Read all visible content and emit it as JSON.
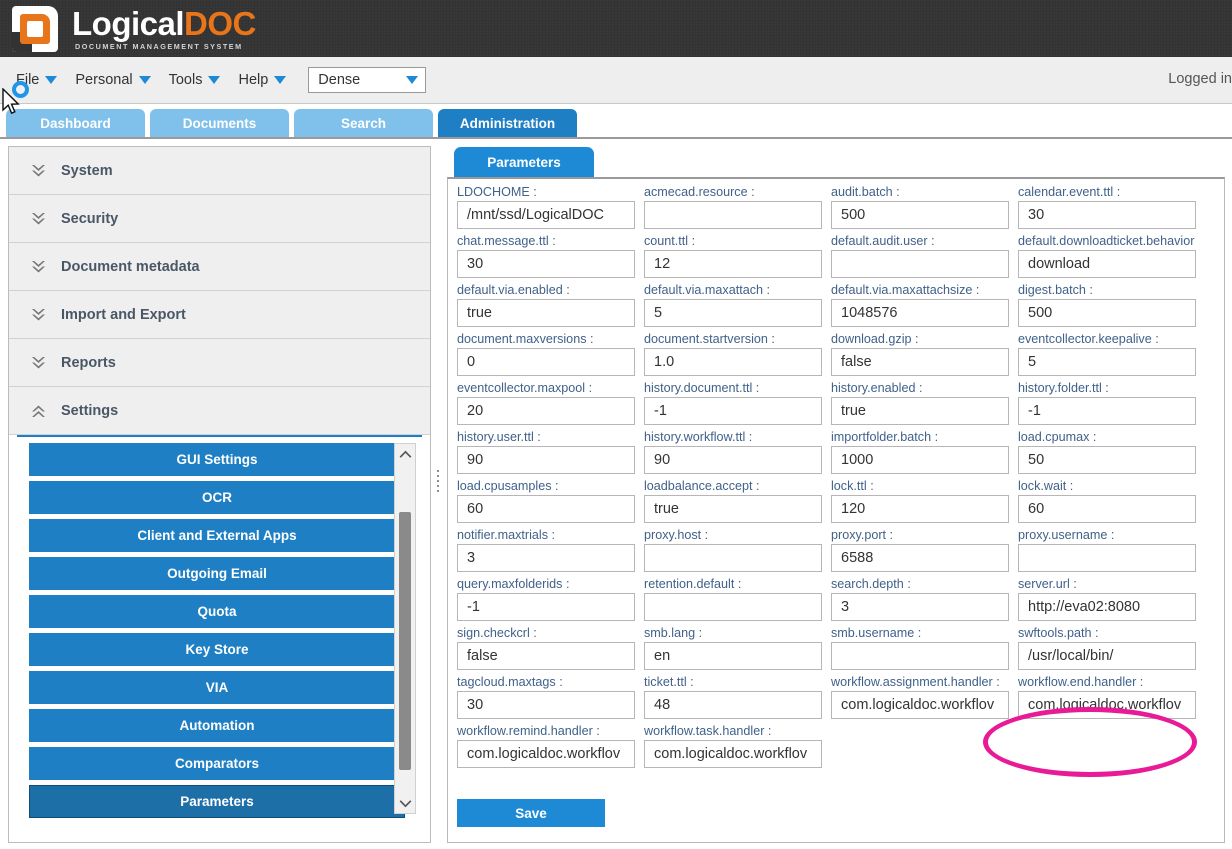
{
  "brand": {
    "name_part1": "Logical",
    "name_part2": "DOC",
    "tagline": "DOCUMENT MANAGEMENT SYSTEM",
    "orange": "#e8751a",
    "blue": "#1e8ad6"
  },
  "menubar": {
    "items": [
      {
        "label": "File",
        "icon": "chevron-down-icon"
      },
      {
        "label": "Personal",
        "icon": "chevron-down-icon"
      },
      {
        "label": "Tools",
        "icon": "chevron-down-icon"
      },
      {
        "label": "Help",
        "icon": "chevron-down-icon"
      }
    ],
    "density": {
      "value": "Dense",
      "icon": "chevron-down-icon"
    },
    "status": "Logged in"
  },
  "tabs": [
    {
      "label": "Dashboard",
      "active": false
    },
    {
      "label": "Documents",
      "active": false
    },
    {
      "label": "Search",
      "active": false
    },
    {
      "label": "Administration",
      "active": true
    }
  ],
  "sidebar": {
    "sections": [
      {
        "label": "System",
        "expanded": false
      },
      {
        "label": "Security",
        "expanded": false
      },
      {
        "label": "Document metadata",
        "expanded": false
      },
      {
        "label": "Import and Export",
        "expanded": false
      },
      {
        "label": "Reports",
        "expanded": false
      },
      {
        "label": "Settings",
        "expanded": true
      }
    ],
    "settings_items": [
      {
        "label": "GUI Settings",
        "selected": false
      },
      {
        "label": "OCR",
        "selected": false
      },
      {
        "label": "Client and External Apps",
        "selected": false
      },
      {
        "label": "Outgoing Email",
        "selected": false
      },
      {
        "label": "Quota",
        "selected": false
      },
      {
        "label": "Key Store",
        "selected": false
      },
      {
        "label": "VIA",
        "selected": false
      },
      {
        "label": "Automation",
        "selected": false
      },
      {
        "label": "Comparators",
        "selected": false
      },
      {
        "label": "Parameters",
        "selected": true
      }
    ]
  },
  "main": {
    "tab_label": "Parameters",
    "save_label": "Save",
    "parameters": [
      {
        "label": "LDOCHOME :",
        "value": "/mnt/ssd/LogicalDOC"
      },
      {
        "label": "acmecad.resource :",
        "value": ""
      },
      {
        "label": "audit.batch :",
        "value": "500"
      },
      {
        "label": "calendar.event.ttl :",
        "value": "30"
      },
      {
        "label": "chat.message.ttl :",
        "value": "30"
      },
      {
        "label": "count.ttl :",
        "value": "12"
      },
      {
        "label": "default.audit.user :",
        "value": ""
      },
      {
        "label": "default.downloadticket.behavior :",
        "value": "download"
      },
      {
        "label": "default.via.enabled :",
        "value": "true"
      },
      {
        "label": "default.via.maxattach :",
        "value": "5"
      },
      {
        "label": "default.via.maxattachsize :",
        "value": "1048576"
      },
      {
        "label": "digest.batch :",
        "value": "500"
      },
      {
        "label": "document.maxversions :",
        "value": "0"
      },
      {
        "label": "document.startversion :",
        "value": "1.0"
      },
      {
        "label": "download.gzip :",
        "value": "false"
      },
      {
        "label": "eventcollector.keepalive :",
        "value": "5"
      },
      {
        "label": "eventcollector.maxpool :",
        "value": "20"
      },
      {
        "label": "history.document.ttl :",
        "value": "-1"
      },
      {
        "label": "history.enabled :",
        "value": "true"
      },
      {
        "label": "history.folder.ttl :",
        "value": "-1"
      },
      {
        "label": "history.user.ttl :",
        "value": "90"
      },
      {
        "label": "history.workflow.ttl :",
        "value": "90"
      },
      {
        "label": "importfolder.batch :",
        "value": "1000"
      },
      {
        "label": "load.cpumax :",
        "value": "50"
      },
      {
        "label": "load.cpusamples :",
        "value": "60"
      },
      {
        "label": "loadbalance.accept :",
        "value": "true"
      },
      {
        "label": "lock.ttl :",
        "value": "120"
      },
      {
        "label": "lock.wait :",
        "value": "60"
      },
      {
        "label": "notifier.maxtrials :",
        "value": "3"
      },
      {
        "label": "proxy.host :",
        "value": ""
      },
      {
        "label": "proxy.port :",
        "value": "6588"
      },
      {
        "label": "proxy.username :",
        "value": ""
      },
      {
        "label": "query.maxfolderids :",
        "value": "-1"
      },
      {
        "label": "retention.default :",
        "value": ""
      },
      {
        "label": "search.depth :",
        "value": "3"
      },
      {
        "label": "server.url :",
        "value": "http://eva02:8080"
      },
      {
        "label": "sign.checkcrl :",
        "value": "false"
      },
      {
        "label": "smb.lang :",
        "value": "en"
      },
      {
        "label": "smb.username :",
        "value": ""
      },
      {
        "label": "swftools.path :",
        "value": "/usr/local/bin/"
      },
      {
        "label": "tagcloud.maxtags :",
        "value": "30"
      },
      {
        "label": "ticket.ttl :",
        "value": "48"
      },
      {
        "label": "workflow.assignment.handler :",
        "value": "com.logicaldoc.workflov"
      },
      {
        "label": "workflow.end.handler :",
        "value": "com.logicaldoc.workflov"
      },
      {
        "label": "workflow.remind.handler :",
        "value": "com.logicaldoc.workflov"
      },
      {
        "label": "workflow.task.handler :",
        "value": "com.logicaldoc.workflov"
      }
    ]
  },
  "annotation": {
    "type": "ellipse-highlight",
    "color": "#e81a96",
    "target": "server.url"
  }
}
